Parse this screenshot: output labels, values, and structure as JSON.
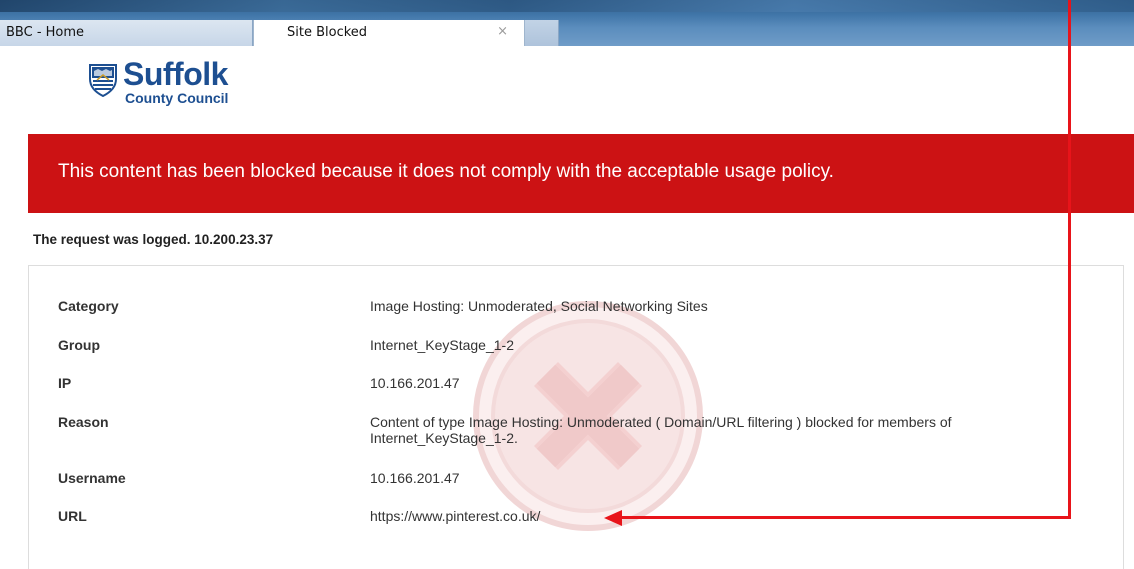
{
  "browser": {
    "tabs": [
      {
        "label": "BBC - Home"
      },
      {
        "label": "Site Blocked",
        "close": "×"
      }
    ]
  },
  "logo": {
    "name": "Suffolk",
    "subtitle": "County Council",
    "emblem": "shield-crest-icon"
  },
  "banner": {
    "message": "This content has been blocked because it does not comply with the acceptable usage policy.",
    "color": "#cc1214"
  },
  "logged": {
    "text": "The request was logged. 10.200.23.37"
  },
  "details": {
    "watermark_icon": "blocked-x-icon",
    "rows": [
      {
        "label": "Category",
        "value": "Image Hosting: Unmoderated, Social Networking Sites"
      },
      {
        "label": "Group",
        "value": "Internet_KeyStage_1-2"
      },
      {
        "label": "IP",
        "value": "10.166.201.47"
      },
      {
        "label": "Reason",
        "value": "Content of type Image Hosting: Unmoderated ( Domain/URL filtering ) blocked for members of Internet_KeyStage_1-2."
      },
      {
        "label": "Username",
        "value": "10.166.201.47"
      },
      {
        "label": "URL",
        "value": "https://www.pinterest.co.uk/"
      }
    ]
  },
  "annotation": {
    "icon": "arrow-left-icon",
    "color": "#e8141a"
  }
}
